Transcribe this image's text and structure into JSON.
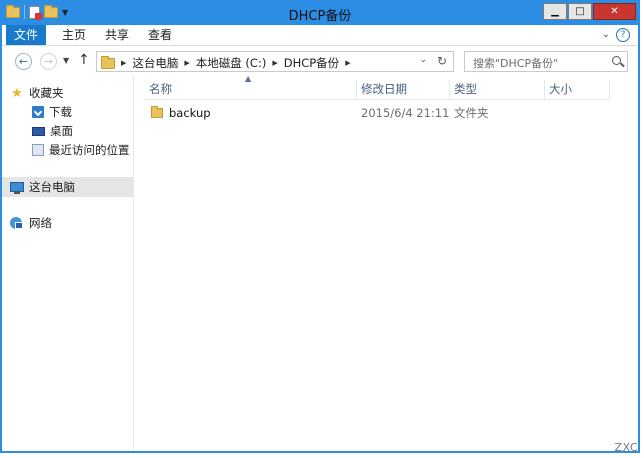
{
  "window": {
    "title": "DHCP备份"
  },
  "ribbon": {
    "tabs": [
      "文件",
      "主页",
      "共享",
      "查看"
    ]
  },
  "address": {
    "crumbs": [
      "这台电脑",
      "本地磁盘 (C:)",
      "DHCP备份"
    ],
    "search_placeholder": "搜索\"DHCP备份\""
  },
  "nav": {
    "favorites": "收藏夹",
    "favorites_items": [
      "下载",
      "桌面",
      "最近访问的位置"
    ],
    "this_pc": "这台电脑",
    "network": "网络"
  },
  "columns": {
    "name": "名称",
    "date": "修改日期",
    "type": "类型",
    "size": "大小"
  },
  "files": [
    {
      "name": "backup",
      "date": "2015/6/4 21:11",
      "type": "文件夹",
      "size": ""
    }
  ],
  "watermark": "ZXC",
  "colors": {
    "accent": "#2b8de3",
    "file_tab": "#1979ca",
    "close": "#c7372f"
  }
}
